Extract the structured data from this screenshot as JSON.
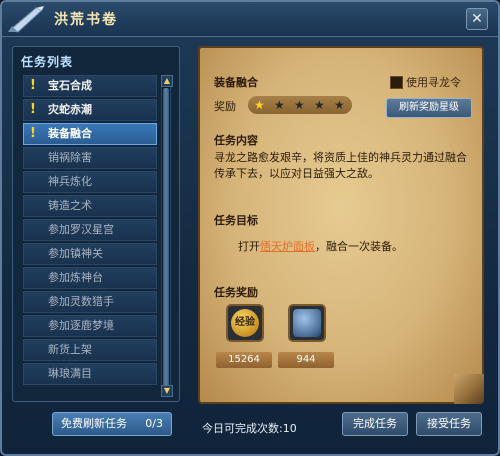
{
  "window": {
    "title": "洪荒书卷",
    "close_glyph": "✕"
  },
  "task_list": {
    "header": "任务列表",
    "items": [
      {
        "label": "宝石合成",
        "has_quest": true,
        "selected": false
      },
      {
        "label": "灾蛇赤潮",
        "has_quest": true,
        "selected": false
      },
      {
        "label": "装备融合",
        "has_quest": true,
        "selected": true
      },
      {
        "label": "销祸除害",
        "has_quest": false,
        "selected": false
      },
      {
        "label": "神兵炼化",
        "has_quest": false,
        "selected": false
      },
      {
        "label": "铸造之术",
        "has_quest": false,
        "selected": false
      },
      {
        "label": "参加罗汉星宫",
        "has_quest": false,
        "selected": false
      },
      {
        "label": "参加镇神关",
        "has_quest": false,
        "selected": false
      },
      {
        "label": "参加炼神台",
        "has_quest": false,
        "selected": false
      },
      {
        "label": "参加灵数猎手",
        "has_quest": false,
        "selected": false
      },
      {
        "label": "参加逐鹿梦境",
        "has_quest": false,
        "selected": false
      },
      {
        "label": "新货上架",
        "has_quest": false,
        "selected": false
      },
      {
        "label": "琳琅满目",
        "has_quest": false,
        "selected": false
      }
    ],
    "quest_mark": "!"
  },
  "free_refresh": {
    "label": "免费刷新任务",
    "count": "0/3"
  },
  "details": {
    "name": "装备融合",
    "reward_label": "奖励",
    "star_rating": 1,
    "star_max": 5,
    "use_token_label": "使用寻龙令",
    "use_token_checked": false,
    "refresh_star_label": "刷新奖励星级",
    "content_title": "任务内容",
    "content_text": "寻龙之路愈发艰辛，将资质上佳的神兵灵力通过融合传承下去，以应对日益强大之敌。",
    "goal_title": "任务目标",
    "goal_prefix": "打开",
    "goal_link": "悟天炉面板",
    "goal_suffix": "，融合一次装备。",
    "rewards_title": "任务奖励",
    "rewards": [
      {
        "icon": "exp-icon",
        "icon_text": "经验",
        "value": "15264"
      },
      {
        "icon": "item-icon",
        "value": "944"
      }
    ]
  },
  "footer": {
    "daily_label": "今日可完成次数:10",
    "complete_label": "完成任务",
    "accept_label": "接受任务"
  },
  "colors": {
    "link": "#e2702a",
    "quest_mark": "#ffd21c",
    "selected": "#3a78b8"
  }
}
